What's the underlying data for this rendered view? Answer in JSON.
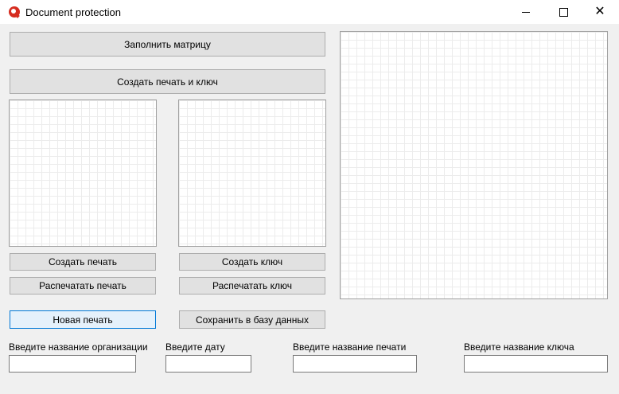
{
  "window": {
    "title": "Document protection",
    "app_icon": "app-logo-icon",
    "controls": [
      "minimize-icon",
      "maximize-icon",
      "close-icon"
    ]
  },
  "buttons": {
    "fill_matrix": "Заполнить матрицу",
    "create_seal_and_key": "Создать печать и ключ",
    "create_seal": "Создать печать",
    "create_key": "Создать ключ",
    "print_seal": "Распечатать печать",
    "print_key": "Распечатать ключ",
    "new_seal": "Новая печать",
    "save_to_db": "Сохранить в базу данных"
  },
  "fields": {
    "organization_label": "Введите название организации",
    "organization_value": "",
    "date_label": "Введите дату",
    "date_value": "",
    "seal_name_label": "Введите название печати",
    "seal_name_value": "",
    "key_name_label": "Введите название ключа",
    "key_name_value": ""
  },
  "colors": {
    "focus_border": "#0078d7",
    "app_icon": "#d62d20"
  }
}
